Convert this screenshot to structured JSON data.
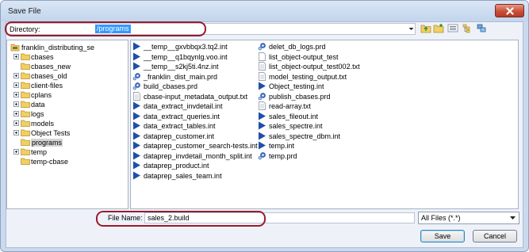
{
  "window": {
    "title": "Save File"
  },
  "directory": {
    "label": "Directory:",
    "value": "/programs"
  },
  "toolbar": {
    "icons": [
      "folder-up-icon",
      "new-folder-icon",
      "list-view-icon",
      "details-view-icon",
      "network-icon"
    ]
  },
  "tree": {
    "root": "franklin_distributing_se",
    "items": [
      {
        "label": "cbases",
        "expandable": true
      },
      {
        "label": "cbases_new",
        "expandable": false
      },
      {
        "label": "cbases_old",
        "expandable": true
      },
      {
        "label": "client-files",
        "expandable": true
      },
      {
        "label": "cplans",
        "expandable": true
      },
      {
        "label": "data",
        "expandable": true
      },
      {
        "label": "logs",
        "expandable": true
      },
      {
        "label": "models",
        "expandable": true
      },
      {
        "label": "Object Tests",
        "expandable": true
      },
      {
        "label": "programs",
        "expandable": false,
        "selected": true
      },
      {
        "label": "temp",
        "expandable": true
      },
      {
        "label": "temp-cbase",
        "expandable": false
      }
    ]
  },
  "files": {
    "col1": [
      {
        "name": "__temp__gxvbbqx3.tq2.int",
        "icon": "arrow"
      },
      {
        "name": "__temp__q1bqynlg.voo.int",
        "icon": "arrow"
      },
      {
        "name": "__temp__s2kj5ti.4nz.int",
        "icon": "arrow"
      },
      {
        "name": "_franklin_dist_main.prd",
        "icon": "gear"
      },
      {
        "name": "build_cbases.prd",
        "icon": "gear"
      },
      {
        "name": "cbase-input_metadata_output.txt",
        "icon": "doc"
      },
      {
        "name": "data_extract_invdetail.int",
        "icon": "arrow"
      },
      {
        "name": "data_extract_queries.int",
        "icon": "arrow"
      },
      {
        "name": "data_extract_tables.int",
        "icon": "arrow"
      },
      {
        "name": "dataprep_customer.int",
        "icon": "arrow"
      },
      {
        "name": "dataprep_customer_search-tests.int",
        "icon": "arrow"
      },
      {
        "name": "dataprep_invdetail_month_split.int",
        "icon": "arrow"
      },
      {
        "name": "dataprep_product.int",
        "icon": "arrow"
      },
      {
        "name": "dataprep_sales_team.int",
        "icon": "arrow"
      }
    ],
    "col2": [
      {
        "name": "delet_db_logs.prd",
        "icon": "gear"
      },
      {
        "name": "list_object-output_test",
        "icon": "blank"
      },
      {
        "name": "list_object-output_test002.txt",
        "icon": "doc"
      },
      {
        "name": "model_testing_output.txt",
        "icon": "doc"
      },
      {
        "name": "Object_testing.int",
        "icon": "arrow"
      },
      {
        "name": "publish_cbases.prd",
        "icon": "gear"
      },
      {
        "name": "read-array.txt",
        "icon": "doc"
      },
      {
        "name": "sales_fileout.int",
        "icon": "arrow"
      },
      {
        "name": "sales_spectre.int",
        "icon": "arrow"
      },
      {
        "name": "sales_spectre_dbm.int",
        "icon": "arrow"
      },
      {
        "name": "temp.int",
        "icon": "arrow"
      },
      {
        "name": "temp.prd",
        "icon": "gear"
      }
    ]
  },
  "filename": {
    "label": "File Name:",
    "value": "sales_2.build"
  },
  "filetype": {
    "value": "All Files (*.*)"
  },
  "buttons": {
    "save": "Save",
    "cancel": "Cancel"
  },
  "colors": {
    "highlight": "#9b1c2c",
    "selection": "#3399ff",
    "arrow_icon": "#1f4fa8"
  }
}
